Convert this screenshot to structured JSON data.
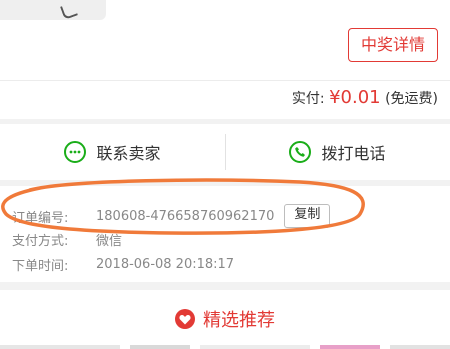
{
  "product": {
    "thumbnail": "product-thumbnail"
  },
  "prize": {
    "button_label": "中奖详情"
  },
  "payment": {
    "label": "实付: ",
    "currency": "¥",
    "amount": "0.01",
    "shipping_note": "(免运费)"
  },
  "actions": {
    "contact_seller": "联系卖家",
    "call_phone": "拨打电话",
    "contact_icon": "chat-bubble-icon",
    "phone_icon": "phone-icon"
  },
  "order": {
    "number_label": "订单编号:",
    "number_value": "180608-476658760962170",
    "copy_label": "复制",
    "payment_method_label": "支付方式:",
    "payment_method_value": "微信",
    "order_time_label": "下单时间:",
    "order_time_value": "2018-06-08 20:18:17"
  },
  "recommend": {
    "title": "精选推荐",
    "icon": "heart-icon"
  },
  "colors": {
    "accent": "#e23a35",
    "green": "#1aad19",
    "annotation": "#f07a3a",
    "muted_text": "#888888"
  }
}
